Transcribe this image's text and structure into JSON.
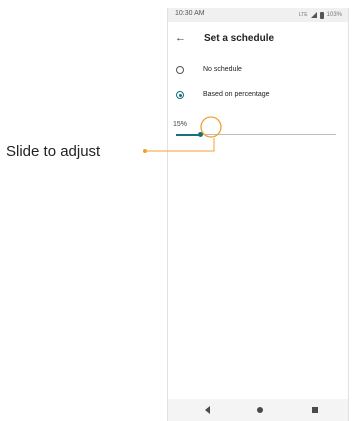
{
  "status_bar": {
    "time": "10:30 AM",
    "network": "LTE",
    "battery": "103%"
  },
  "app_bar": {
    "back_icon": "arrow-left-icon",
    "title": "Set a schedule"
  },
  "options": [
    {
      "label": "No schedule",
      "selected": false
    },
    {
      "label": "Based on percentage",
      "selected": true
    }
  ],
  "slider": {
    "value_label": "15%",
    "value_fraction": 0.15
  },
  "nav_bar": {
    "back_icon": "triangle-back-icon",
    "home_icon": "circle-home-icon",
    "recent_icon": "square-recent-icon"
  },
  "callout": {
    "text": "Slide to adjust",
    "color": "#f0a030"
  },
  "colors": {
    "accent": "#1a6f7c",
    "callout": "#f0a030"
  }
}
